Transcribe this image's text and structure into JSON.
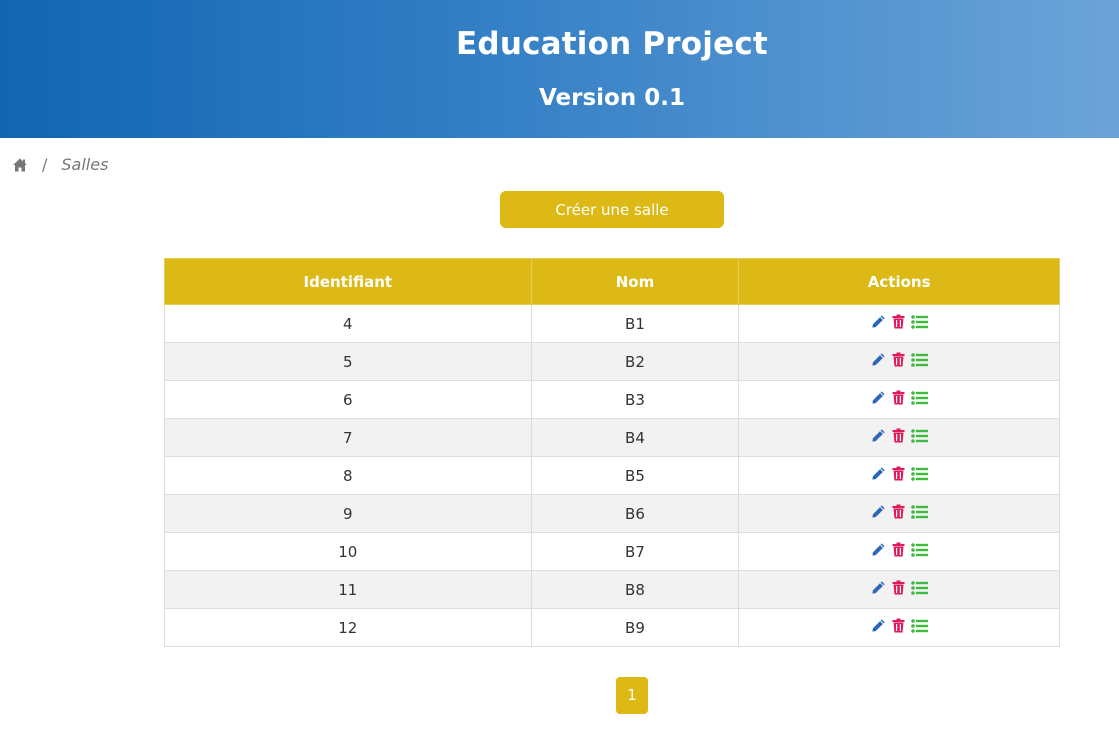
{
  "header": {
    "title": "Education Project",
    "version": "Version 0.1"
  },
  "breadcrumb": {
    "home_icon": "home-icon",
    "separator": "/",
    "current": "Salles"
  },
  "create_button": {
    "label": "Créer une salle"
  },
  "table": {
    "columns": [
      "Identifiant",
      "Nom",
      "Actions"
    ],
    "rows": [
      {
        "id": "4",
        "nom": "B1"
      },
      {
        "id": "5",
        "nom": "B2"
      },
      {
        "id": "6",
        "nom": "B3"
      },
      {
        "id": "7",
        "nom": "B4"
      },
      {
        "id": "8",
        "nom": "B5"
      },
      {
        "id": "9",
        "nom": "B6"
      },
      {
        "id": "10",
        "nom": "B7"
      },
      {
        "id": "11",
        "nom": "B8"
      },
      {
        "id": "12",
        "nom": "B9"
      }
    ],
    "action_icons": [
      "pencil-icon",
      "trash-icon",
      "list-icon"
    ]
  },
  "pagination": {
    "current_page": "1"
  },
  "colors": {
    "accent": "#dcb914",
    "header_start": "#1165b2",
    "header_end": "#6ca4d8",
    "edit": "#2f67b8",
    "delete": "#e0195a",
    "list": "#3dbb3d"
  }
}
